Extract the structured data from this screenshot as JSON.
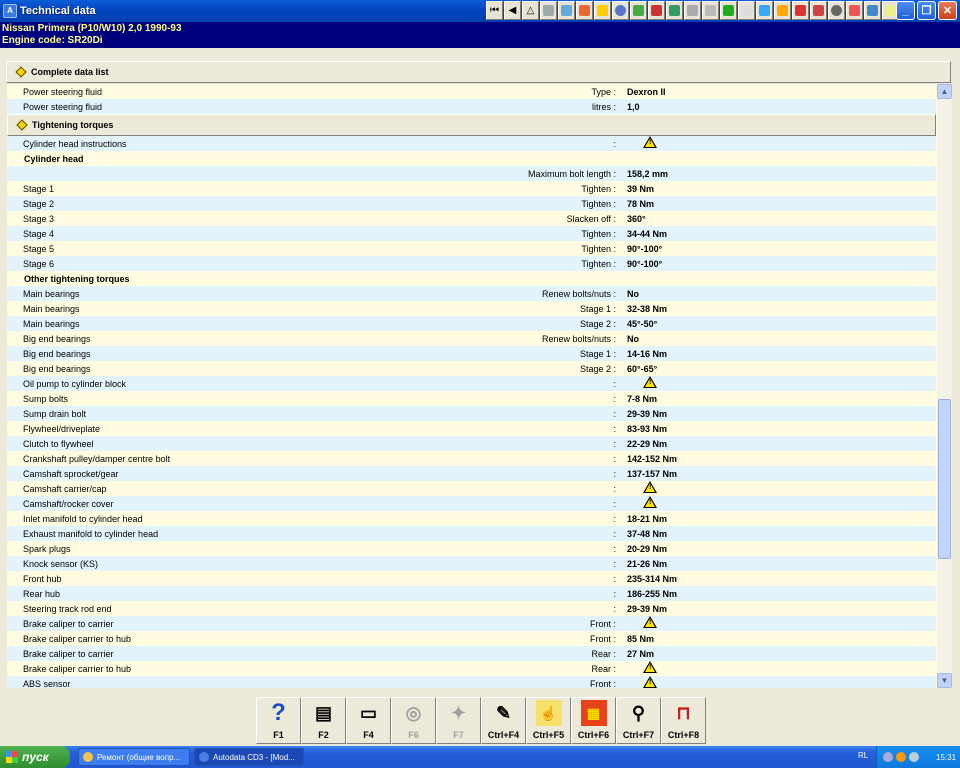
{
  "window": {
    "title": "Technical data"
  },
  "vehicle": {
    "line1": "Nissan   Primera (P10/W10) 2,0  1990-93",
    "line2": "Engine code: SR20Di"
  },
  "sections": {
    "complete": "Complete data list",
    "torques": "Tightening torques"
  },
  "rows_top": [
    {
      "desc": "Power steering fluid",
      "qual": "Type :",
      "val": "Dexron II"
    },
    {
      "desc": "Power steering fluid",
      "qual": "litres :",
      "val": "1,0"
    }
  ],
  "rows": [
    {
      "desc": "Cylinder head instructions",
      "qual": ":",
      "warn": true
    },
    {
      "desc": "Cylinder head",
      "sub": true
    },
    {
      "desc": "",
      "qual": "Maximum bolt length :",
      "val": "158,2 mm"
    },
    {
      "desc": "Stage 1",
      "qual": "Tighten :",
      "val": "39 Nm"
    },
    {
      "desc": "Stage 2",
      "qual": "Tighten :",
      "val": "78 Nm"
    },
    {
      "desc": "Stage 3",
      "qual": "Slacken off :",
      "val": "360°"
    },
    {
      "desc": "Stage 4",
      "qual": "Tighten :",
      "val": "34-44 Nm"
    },
    {
      "desc": "Stage 5",
      "qual": "Tighten :",
      "val": "90°-100°"
    },
    {
      "desc": "Stage 6",
      "qual": "Tighten :",
      "val": "90°-100°"
    },
    {
      "desc": "Other tightening torques",
      "sub": true
    },
    {
      "desc": "Main bearings",
      "qual": "Renew bolts/nuts :",
      "val": "No"
    },
    {
      "desc": "Main bearings",
      "qual": "Stage 1 :",
      "val": "32-38 Nm"
    },
    {
      "desc": "Main bearings",
      "qual": "Stage 2 :",
      "val": "45°-50°"
    },
    {
      "desc": "Big end bearings",
      "qual": "Renew bolts/nuts :",
      "val": "No"
    },
    {
      "desc": "Big end bearings",
      "qual": "Stage 1 :",
      "val": "14-16 Nm"
    },
    {
      "desc": "Big end bearings",
      "qual": "Stage 2 :",
      "val": "60°-65°"
    },
    {
      "desc": "Oil pump to cylinder block",
      "qual": ":",
      "warn": true
    },
    {
      "desc": "Sump bolts",
      "qual": ":",
      "val": "7-8 Nm"
    },
    {
      "desc": "Sump drain bolt",
      "qual": ":",
      "val": "29-39 Nm"
    },
    {
      "desc": "Flywheel/driveplate",
      "qual": ":",
      "val": "83-93 Nm"
    },
    {
      "desc": "Clutch to flywheel",
      "qual": ":",
      "val": "22-29 Nm"
    },
    {
      "desc": "Crankshaft pulley/damper centre bolt",
      "qual": ":",
      "val": "142-152 Nm"
    },
    {
      "desc": "Camshaft sprocket/gear",
      "qual": ":",
      "val": "137-157 Nm"
    },
    {
      "desc": "Camshaft carrier/cap",
      "qual": ":",
      "warn": true
    },
    {
      "desc": "Camshaft/rocker cover",
      "qual": ":",
      "warn": true
    },
    {
      "desc": "Inlet manifold to cylinder head",
      "qual": ":",
      "val": "18-21 Nm"
    },
    {
      "desc": "Exhaust manifold to cylinder head",
      "qual": ":",
      "val": "37-48 Nm"
    },
    {
      "desc": "Spark plugs",
      "qual": ":",
      "val": "20-29 Nm"
    },
    {
      "desc": "Knock sensor (KS)",
      "qual": ":",
      "val": "21-26 Nm"
    },
    {
      "desc": "Front hub",
      "qual": ":",
      "val": "235-314 Nm"
    },
    {
      "desc": "Rear hub",
      "qual": ":",
      "val": "186-255 Nm"
    },
    {
      "desc": "Steering track rod end",
      "qual": ":",
      "val": "29-39 Nm"
    },
    {
      "desc": "Brake caliper to carrier",
      "qual": "Front :",
      "warn": true
    },
    {
      "desc": "Brake caliper carrier to hub",
      "qual": "Front :",
      "val": "85 Nm"
    },
    {
      "desc": "Brake caliper to carrier",
      "qual": "Rear :",
      "val": "27 Nm"
    },
    {
      "desc": "Brake caliper carrier to hub",
      "qual": "Rear :",
      "warn": true
    },
    {
      "desc": "ABS sensor",
      "qual": "Front :",
      "warn": true
    }
  ],
  "fkeys": [
    {
      "label": "F1",
      "icon": "help-icon",
      "glyph": "?",
      "enabled": true
    },
    {
      "label": "F2",
      "icon": "printer-icon",
      "glyph": "▤",
      "enabled": true
    },
    {
      "label": "F4",
      "icon": "monitor-icon",
      "glyph": "▭",
      "enabled": true
    },
    {
      "label": "F6",
      "icon": "cd-icon",
      "glyph": "◎",
      "enabled": false
    },
    {
      "label": "F7",
      "icon": "tool-icon",
      "glyph": "✦",
      "enabled": false
    },
    {
      "label": "Ctrl+F4",
      "icon": "document-edit-icon",
      "glyph": "✎",
      "enabled": true
    },
    {
      "label": "Ctrl+F5",
      "icon": "bookmark-pin-icon",
      "glyph": "☝",
      "enabled": true
    },
    {
      "label": "Ctrl+F6",
      "icon": "calendar-icon",
      "glyph": "▦",
      "enabled": true
    },
    {
      "label": "Ctrl+F7",
      "icon": "search-magnifier-icon",
      "glyph": "⚲",
      "enabled": true
    },
    {
      "label": "Ctrl+F8",
      "icon": "car-lift-icon",
      "glyph": "⊓",
      "enabled": true
    }
  ],
  "taskbar": {
    "start": "пуск",
    "tasks": [
      "Ремонт (общие вопр...",
      "Autodata CD3 - [Mod..."
    ],
    "lang": "RL",
    "clock": "15:31"
  },
  "colors": {
    "row_yellow": "#fffbe0",
    "row_blue": "#e2f3fb",
    "info_bg": "#00007f",
    "info_text": "#ffff80"
  }
}
